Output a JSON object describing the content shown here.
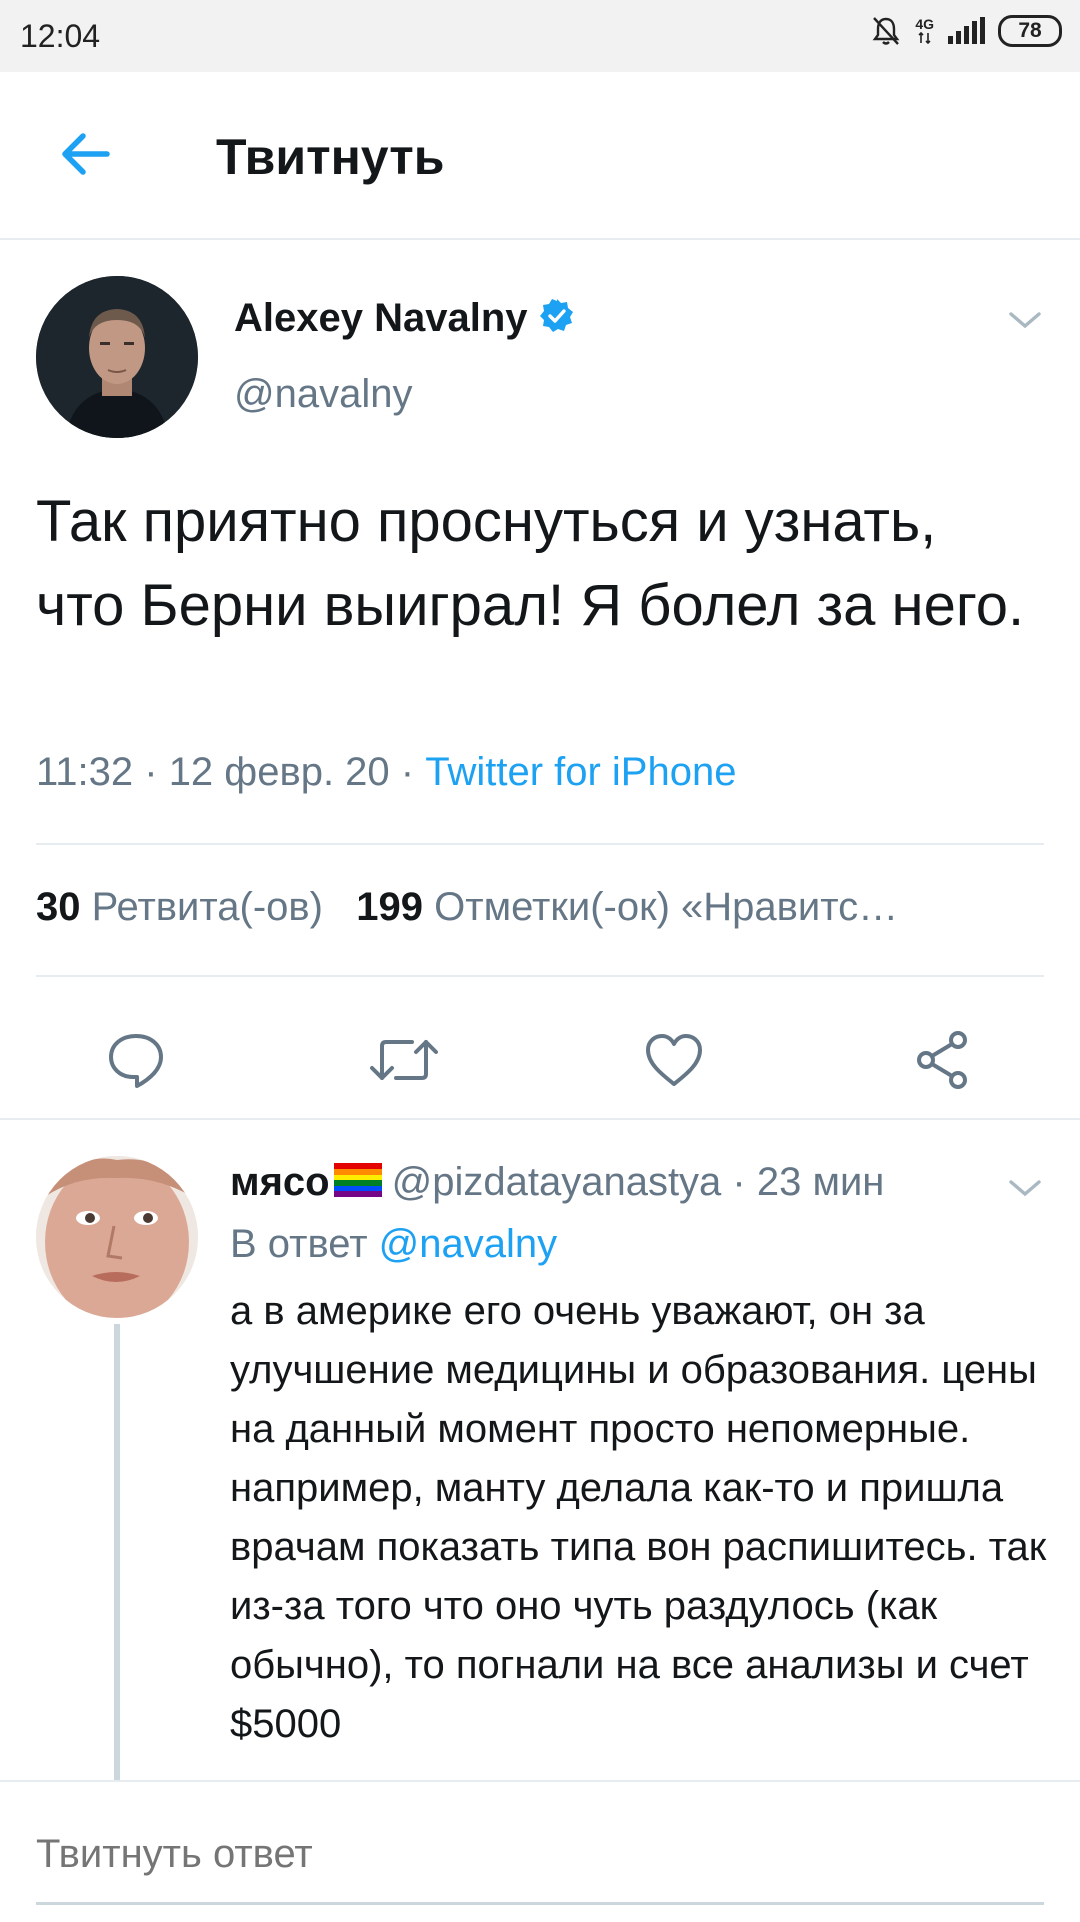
{
  "status_bar": {
    "time": "12:04",
    "network": "4G",
    "battery": "78"
  },
  "header": {
    "title": "Твитнуть"
  },
  "tweet": {
    "author_name": "Alexey Navalny",
    "author_handle": "@navalny",
    "text": "Так приятно проснуться и узнать, что Берни выиграл! Я болел за него.",
    "time": "11:32",
    "date": "12 февр. 20",
    "source": "Twitter for iPhone",
    "retweets_count": "30",
    "retweets_label": "Ретвита(-ов)",
    "likes_count": "199",
    "likes_label": "Отметки(-ок) «Нравитс…"
  },
  "reply": {
    "name": "мясо",
    "handle": "@pizdatayanastya",
    "time": "23 мин",
    "reply_to_label": "В ответ",
    "reply_to_handle": "@navalny",
    "text": "а в америке его очень уважают, он за улучшение медицины и образования. цены на данный момент просто непомерные. например, манту делала как-то и пришла врачам показать типа вон распишитесь. так из-за того что оно чуть раздулось (как обычно), то погнали на все анализы и счет $5000"
  },
  "compose": {
    "placeholder": "Твитнуть ответ"
  },
  "icons": {
    "back": "arrow-left-icon",
    "verified": "verified-badge-icon",
    "reply": "speech-bubble-icon",
    "retweet": "retweet-icon",
    "like": "heart-icon",
    "share": "share-icon",
    "caret": "chevron-down-icon"
  },
  "colors": {
    "accent": "#1da1f2",
    "secondary_text": "#657786",
    "primary_text": "#14171a",
    "divider": "#e6ecf0"
  }
}
